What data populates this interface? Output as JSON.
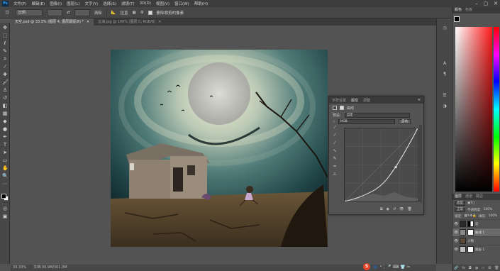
{
  "app": {
    "logo": "Ps",
    "menus": [
      "文件(F)",
      "编辑(E)",
      "图像(I)",
      "图层(L)",
      "文字(Y)",
      "选择(S)",
      "滤镜(T)",
      "3D(D)",
      "视图(V)",
      "窗口(W)",
      "帮助(H)"
    ],
    "window_controls": [
      "–",
      "▢",
      "✕"
    ]
  },
  "options_bar": {
    "tool_icon": "crop-icon",
    "preset": "比例",
    "clear_label": "清除",
    "straighten_label": "拉直",
    "grid_label": "▦",
    "settings_label": "⚙",
    "delete_label": "删除裁剪的像素",
    "content_aware": "✓"
  },
  "tabs": [
    {
      "title": "天空.psd @ 33.3% (图层 4, 图层蒙版/8) *",
      "active": true
    },
    {
      "title": "云海.jpg @ 100% (图层 0, RGB/8)",
      "active": false
    }
  ],
  "status": {
    "zoom": "33.33%",
    "doc": "文档:30.9M/301.3M"
  },
  "properties": {
    "tabs": [
      "字符设置",
      "属性",
      "调整"
    ],
    "active_tab": 1,
    "title": "曲线",
    "preset_label": "预设:",
    "preset_value": "自定",
    "channel_value": "RGB",
    "auto_label": "自动",
    "curve_points": [
      [
        0,
        0
      ],
      [
        0.22,
        0.06
      ],
      [
        0.5,
        0.2
      ],
      [
        0.7,
        0.47
      ],
      [
        0.86,
        0.74
      ],
      [
        1,
        1
      ]
    ]
  },
  "right_panels": {
    "tabs": [
      "颜色",
      "色板"
    ],
    "layer_tabs": [
      "图层",
      "通道",
      "路径"
    ],
    "active_layer_tab": 0,
    "kind_label": "类型",
    "blend_mode": "正常",
    "opacity_label": "不透明度:",
    "opacity_value": "100%",
    "lock_label": "锁定:",
    "fill_label": "填充:",
    "fill_value": "100%",
    "layers": [
      {
        "name": "云",
        "selected": false,
        "thumb": "#2a2a2a",
        "mask": true
      },
      {
        "name": "曲线 1",
        "selected": true,
        "thumb": "#8a8a8a",
        "mask": true
      },
      {
        "name": "人物",
        "selected": false,
        "thumb": "#5a4a3a",
        "mask": false
      },
      {
        "name": "图层 1",
        "selected": false,
        "thumb": "#bfbfbf",
        "mask": true
      }
    ]
  },
  "ime": {
    "s": "S",
    "lang": "中",
    "icons": "ᵒ ,̈ 🎤 ⌨ 👕 ✂"
  },
  "colors": {
    "accent": "#31a8ff",
    "panel": "#535353",
    "dark": "#474747"
  }
}
